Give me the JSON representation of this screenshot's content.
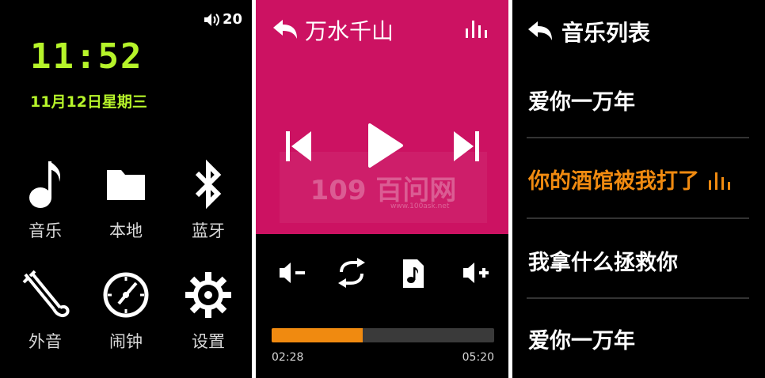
{
  "screen1": {
    "volume_value": "20",
    "time": "11:52",
    "date": "11月12日星期三",
    "apps": [
      {
        "label": "音乐",
        "icon": "music-note-icon"
      },
      {
        "label": "本地",
        "icon": "folder-icon"
      },
      {
        "label": "蓝牙",
        "icon": "bluetooth-icon"
      },
      {
        "label": "外音",
        "icon": "cable-icon"
      },
      {
        "label": "闹钟",
        "icon": "clock-icon"
      },
      {
        "label": "设置",
        "icon": "gear-icon"
      }
    ]
  },
  "screen2": {
    "title": "万水千山",
    "watermark": "109 百问网",
    "watermark_url": "www.100ask.net",
    "progress_fraction": 0.41,
    "current_time": "02:28",
    "total_time": "05:20",
    "colors": {
      "accent": "#cc1262",
      "progress": "#f08a10"
    }
  },
  "screen3": {
    "title": "音乐列表",
    "songs": [
      {
        "title": "爱你一万年",
        "playing": false
      },
      {
        "title": "你的酒馆被我打了",
        "playing": true
      },
      {
        "title": "我拿什么拯救你",
        "playing": false
      },
      {
        "title": "爱你一万年",
        "playing": false
      }
    ],
    "colors": {
      "active": "#f08a10"
    }
  }
}
